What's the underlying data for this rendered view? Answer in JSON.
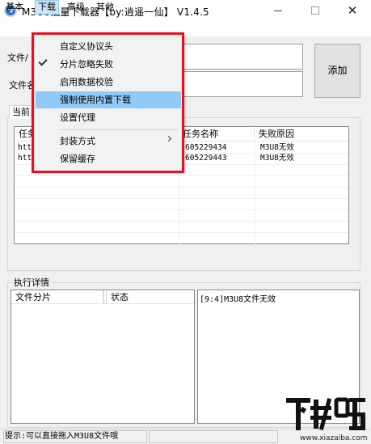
{
  "window": {
    "title": "M3U8批量下载器【by:逍遥一仙】 V1.4.5",
    "controls": {
      "minimize": "minimize",
      "maximize": "maximize",
      "close": "✕"
    }
  },
  "menubar": {
    "items": [
      {
        "label": "基本"
      },
      {
        "label": "下载"
      },
      {
        "label": "高级"
      },
      {
        "label": "其他"
      }
    ]
  },
  "dropdown": {
    "items": [
      {
        "label": "自定义协议头",
        "checked": false,
        "highlighted": false
      },
      {
        "label": "分片忽略失败",
        "checked": true,
        "highlighted": false
      },
      {
        "label": "启用数据校验",
        "checked": false,
        "highlighted": false
      },
      {
        "label": "强制使用内置下载",
        "checked": false,
        "highlighted": true
      },
      {
        "label": "设置代理",
        "checked": false,
        "highlighted": false
      },
      {
        "label": "封装方式",
        "checked": false,
        "highlighted": false,
        "submenu": true
      },
      {
        "label": "保留缓存",
        "checked": false,
        "highlighted": false
      }
    ],
    "highlight_color": "#e8101e"
  },
  "form": {
    "file_label": "文件/",
    "name_label": "文件名",
    "file_value": "",
    "name_value": "",
    "add_button": "添加"
  },
  "tasks": {
    "tab_label": "当前",
    "columns": [
      "任务",
      "任务名称",
      "失败原因"
    ],
    "rows": [
      {
        "task": "htt",
        "name": "605229434",
        "reason": "M3U8无效"
      },
      {
        "task": "htt",
        "name": "605229443",
        "reason": "M3U8无效"
      }
    ]
  },
  "execution": {
    "title": "执行详情",
    "columns": [
      "文件分片",
      "状态"
    ],
    "log": "[9:4]M3U8文件无效"
  },
  "statusbar": {
    "hint": "提示:可以直接拖入M3U8文件哦"
  },
  "watermark": {
    "logo": "下载吧",
    "url": "www.xiazaiba.com"
  },
  "colors": {
    "menu_hover": "#91c9f7",
    "annotation_red": "#e8101e",
    "window_bg": "#f0f0f0"
  }
}
